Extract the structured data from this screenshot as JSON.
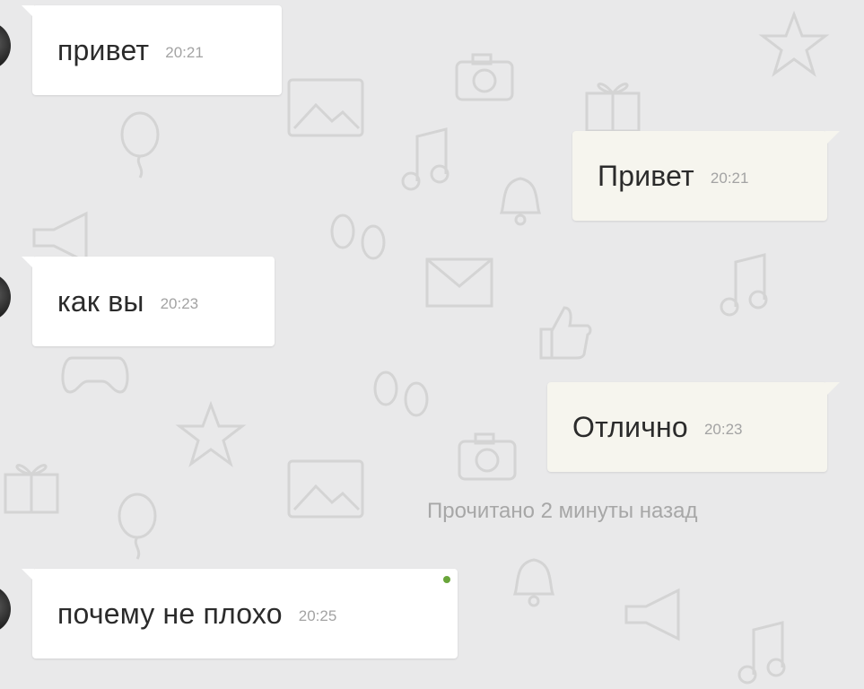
{
  "colors": {
    "background": "#e9e9ea",
    "incoming_bubble": "#ffffff",
    "outgoing_bubble": "#f6f5ee",
    "text": "#2b2b2b",
    "time": "#a3a3a3",
    "status": "#a7a7a7",
    "online_dot": "#69a53a"
  },
  "messages": [
    {
      "direction": "in",
      "text": "привет",
      "time": "20:21"
    },
    {
      "direction": "out",
      "text": "Привет",
      "time": "20:21"
    },
    {
      "direction": "in",
      "text": "как вы",
      "time": "20:23"
    },
    {
      "direction": "out",
      "text": "Отлично",
      "time": "20:23"
    },
    {
      "direction": "in",
      "text": "почему не плохо",
      "time": "20:25"
    }
  ],
  "read_status": "Прочитано 2 минуты назад",
  "icons": [
    "camera-icon",
    "star-icon",
    "music-note-icon",
    "bell-icon",
    "envelope-icon",
    "gift-icon",
    "balloon-icon",
    "thumbs-up-icon",
    "footprints-icon",
    "gamepad-icon",
    "picture-icon",
    "megaphone-icon"
  ]
}
